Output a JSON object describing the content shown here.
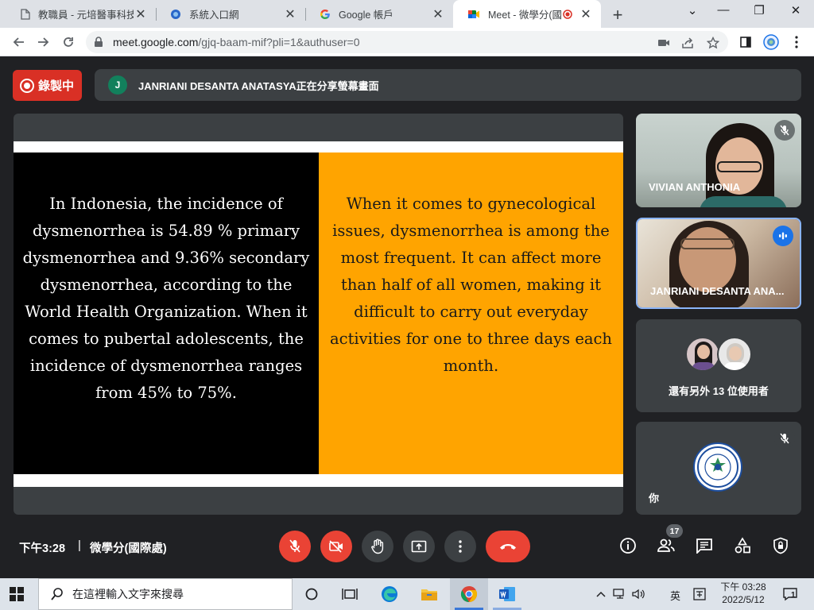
{
  "browser": {
    "tabs": [
      {
        "title": "教職員 - 元培醫事科技",
        "icon": "document-icon"
      },
      {
        "title": "系統入口網",
        "icon": "globe-icon"
      },
      {
        "title": "Google 帳戶",
        "icon": "google-icon"
      },
      {
        "title": "Meet - 微學分(國際",
        "icon": "meet-icon",
        "recording": true,
        "active": true
      }
    ],
    "url_main": "meet.google.com",
    "url_rest": "/gjq-baam-mif?pli=1&authuser=0",
    "window_controls": {
      "minimize": "—",
      "restore": "❐",
      "close": "✕"
    },
    "new_tab": "+"
  },
  "meet": {
    "recording_label": "錄製中",
    "presenter_initial": "J",
    "presenting_text": "JANRIANI DESANTA ANATASYA正在分享螢幕畫面",
    "slide": {
      "left_text": "In Indonesia, the incidence of dysmenorrhea is 54.89 % primary dysmenorrhea  and 9.36% secondary dysmenorrhea, according to the World Health Organization. When it comes to pubertal adolescents, the incidence of dysmenorrhea ranges from 45% to 75%.",
      "right_text": "When it comes to gynecological issues, dysmenorrhea is among the most frequent. It can affect more than half of all women, making it difficult to carry out everyday activities for one to three days each month."
    },
    "participants": {
      "tile1_name": "VIVIAN ANTHONIA",
      "tile2_name": "JANRIANI DESANTA ANA...",
      "others_label": "還有另外 13 位使用者",
      "self_label": "你"
    },
    "bottom_bar": {
      "time": "下午3:28",
      "separator": "|",
      "meeting_name": "微學分(國際處)",
      "participant_count": "17"
    },
    "colors": {
      "recording": "#d93025",
      "slide_orange": "#ffa400",
      "control_red": "#ea4335",
      "speaking_blue": "#1a73e8"
    }
  },
  "taskbar": {
    "search_placeholder": "在這裡輸入文字來搜尋",
    "ime_lang": "英",
    "clock_time": "下午 03:28",
    "clock_date": "2022/5/12",
    "notifications": "1"
  }
}
